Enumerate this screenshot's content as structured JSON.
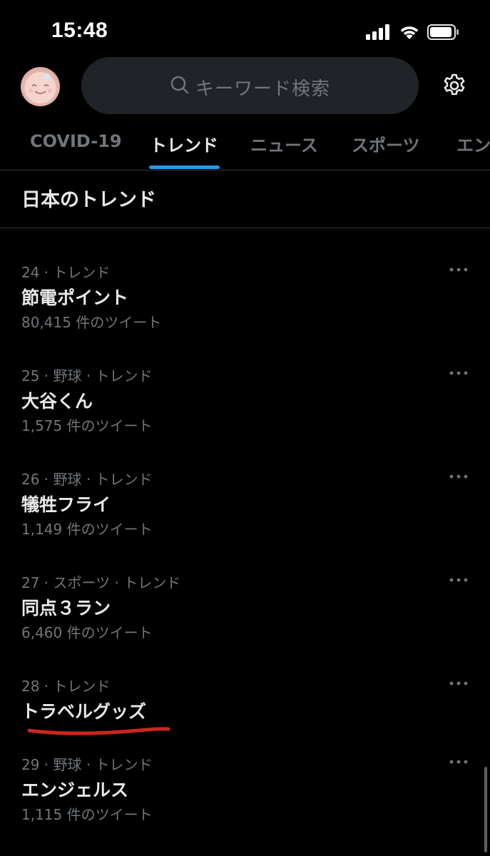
{
  "status_bar": {
    "time": "15:48",
    "icons": [
      "signal-icon",
      "wifi-icon",
      "battery-icon"
    ]
  },
  "header": {
    "avatar": "avatar",
    "search": {
      "placeholder": "キーワード検索",
      "icon": "search-icon"
    },
    "settings_icon": "gear-icon"
  },
  "tabs": [
    {
      "label": "COVID-19",
      "active": false
    },
    {
      "label": "トレンド",
      "active": true
    },
    {
      "label": "ニュース",
      "active": false
    },
    {
      "label": "スポーツ",
      "active": false
    },
    {
      "label": "エン",
      "active": false
    }
  ],
  "section_title": "日本のトレンド",
  "trends": [
    {
      "rank": "24",
      "meta": "24 · トレンド",
      "name": "節電ポイント",
      "count": "80,415 件のツイート"
    },
    {
      "rank": "25",
      "meta": "25 · 野球 · トレンド",
      "name": "大谷くん",
      "count": "1,575 件のツイート"
    },
    {
      "rank": "26",
      "meta": "26 · 野球 · トレンド",
      "name": "犠牲フライ",
      "count": "1,149 件のツイート"
    },
    {
      "rank": "27",
      "meta": "27 · スポーツ · トレンド",
      "name": "同点３ラン",
      "count": "6,460 件のツイート"
    },
    {
      "rank": "28",
      "meta": "28 · トレンド",
      "name": "トラベルグッズ",
      "count": "",
      "annotation": "red-underline"
    },
    {
      "rank": "29",
      "meta": "29 · 野球 · トレンド",
      "name": "エンジェルス",
      "count": "1,115 件のツイート"
    }
  ],
  "colors": {
    "background": "#000000",
    "accent": "#1d9bf0",
    "secondary_text": "#71767b",
    "annotation": "#c8281e"
  }
}
